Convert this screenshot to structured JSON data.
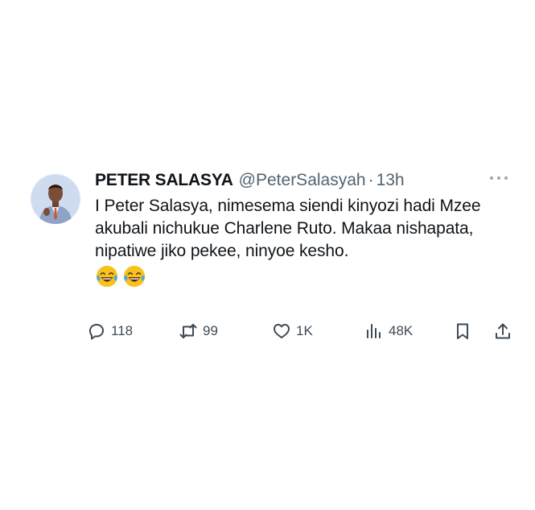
{
  "tweet": {
    "author_name": "PETER SALASYA",
    "author_handle": "@PeterSalasyah",
    "separator": "·",
    "time": "13h",
    "text": "I Peter Salasya, nimesema siendi kinyozi hadi Mzee akubali nichukue Charlene Ruto. Makaa nishapata, nipatiwe jiko pekee, ninyoe kesho.",
    "emojis": [
      "face-with-tears-of-joy-icon",
      "face-with-tears-of-joy-icon"
    ]
  },
  "actions": {
    "replies": "118",
    "reposts": "99",
    "likes": "1K",
    "views": "48K"
  },
  "colors": {
    "text": "#0f1419",
    "secondary": "#536471",
    "icon": "#3e4a55",
    "emoji_face": "#f7c21e",
    "emoji_tears": "#4aa8e8"
  }
}
